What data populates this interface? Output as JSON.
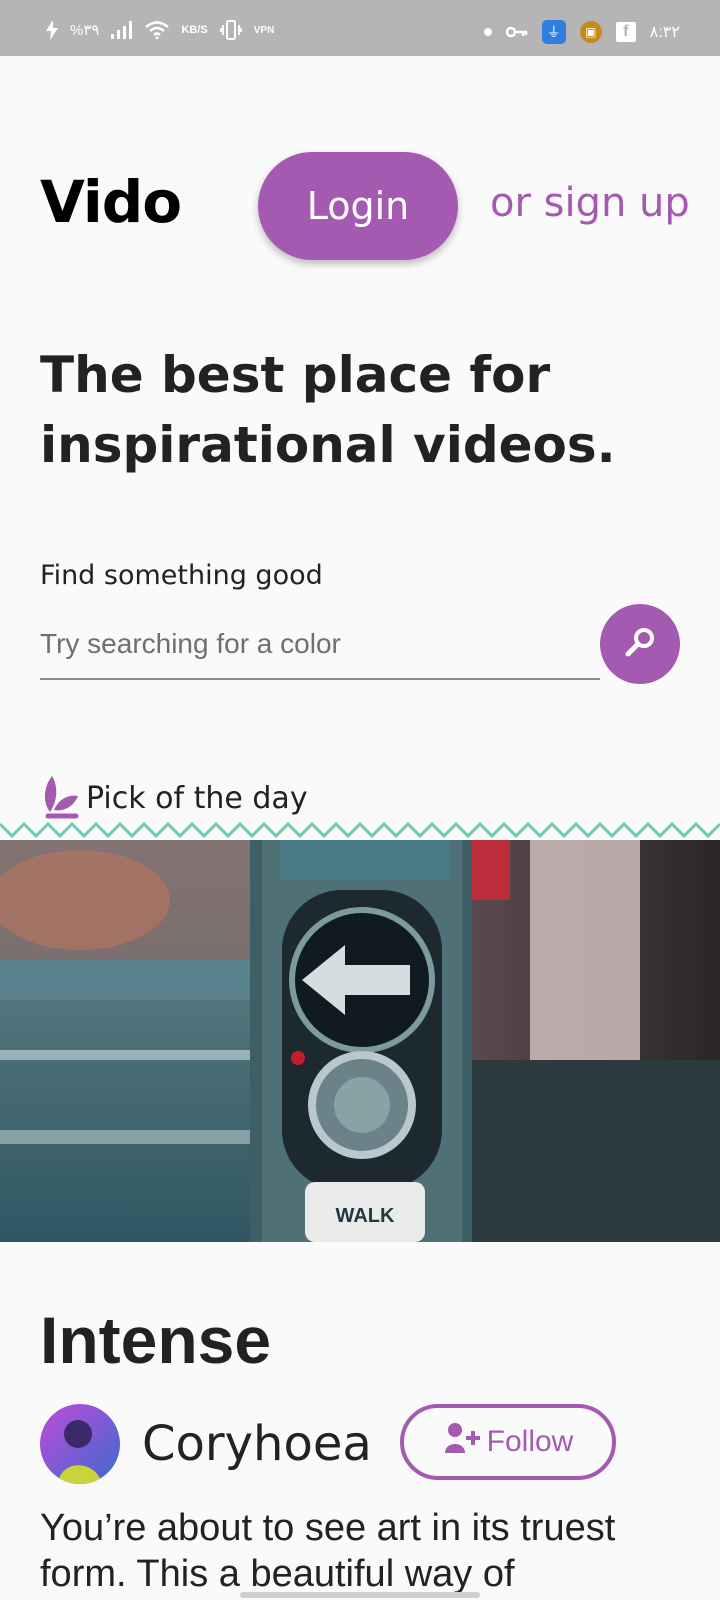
{
  "status_bar": {
    "battery": "%۳۹",
    "network_speed": "KB/S",
    "vpn": "VPN",
    "time": "۸:۳۲",
    "icons": [
      "charging-icon",
      "signal-icon",
      "wifi-icon",
      "vibrate-icon",
      "vpn-icon",
      "dot-icon",
      "key-icon",
      "usb-icon",
      "app-icon",
      "facebook-icon"
    ]
  },
  "header": {
    "logo": "Vido",
    "login_label": "Login",
    "signup_label": "or sign up"
  },
  "hero": {
    "title": "The best place for inspirational videos."
  },
  "search": {
    "label": "Find something good",
    "placeholder": "Try searching for a color"
  },
  "pick": {
    "label": "Pick of the day",
    "photo_caption": "WALK"
  },
  "video": {
    "title": "Intense",
    "author": "Coryhoea",
    "follow_label": "Follow",
    "description": "You’re about to see art in its truest form. This a beautiful way of"
  },
  "colors": {
    "accent": "#a45ab0",
    "zigzag": "#6fc9b4",
    "statusbar": "#b5b5b5"
  }
}
